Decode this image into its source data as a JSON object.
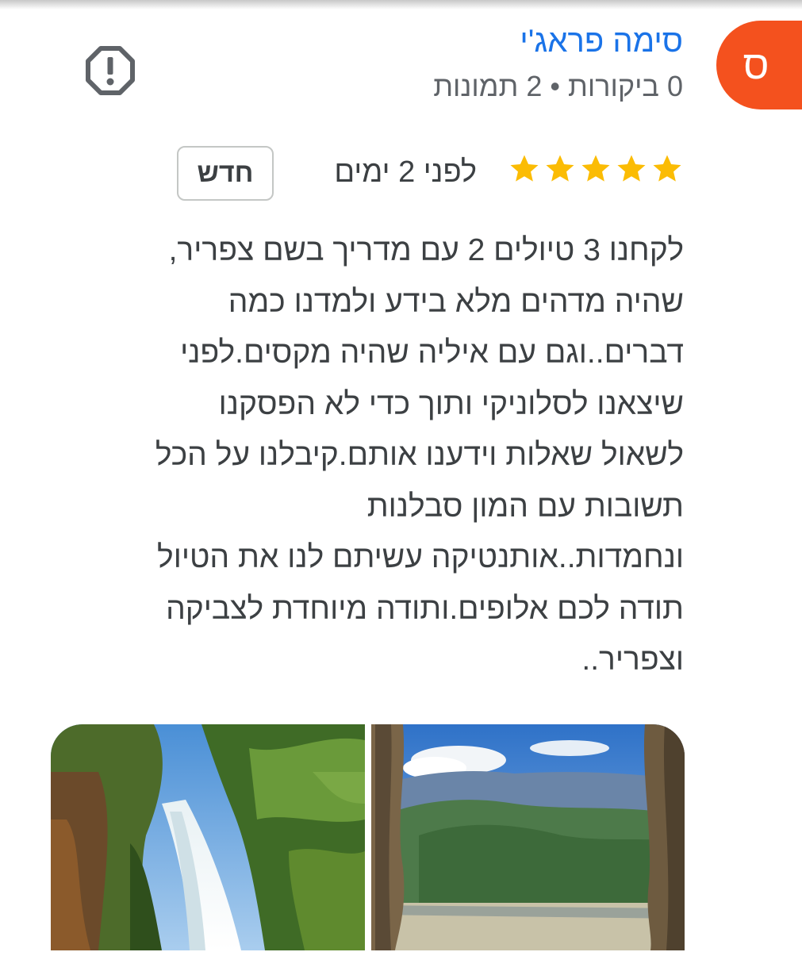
{
  "reviewer": {
    "avatar_letter": "ס",
    "name": "סימה פראג'י",
    "stats": "0 ביקורות • 2 תמונות"
  },
  "review": {
    "rating": 5,
    "max_rating": 5,
    "date": "לפני 2 ימים",
    "badge": "חדש",
    "text_lines": [
      "לקחנו 3 טיולים 2 עם מדריך בשם צפריר,",
      "שהיה מדהים מלא בידע ולמדנו כמה",
      "דברים..וגם עם איליה שהיה מקסים.לפני",
      "שיצאנו לסלוניקי ותוך כדי לא הפסקנו",
      "לשאול שאלות וידענו אותם.קיבלנו על הכל",
      "תשובות עם המון סבלנות",
      "ונחמדות..אותנטיקה עשיתם לנו את הטיול",
      "תודה לכם אלופים.ותודה מיוחדת לצביקה",
      "וצפריר.."
    ]
  },
  "icons": {
    "flag": "report-flag-icon",
    "star": "star-icon"
  },
  "colors": {
    "avatar": "#f4511e",
    "name_link": "#1a73e8",
    "star": "#fbbc04",
    "text": "#3c4043",
    "secondary_text": "#5f6368"
  }
}
